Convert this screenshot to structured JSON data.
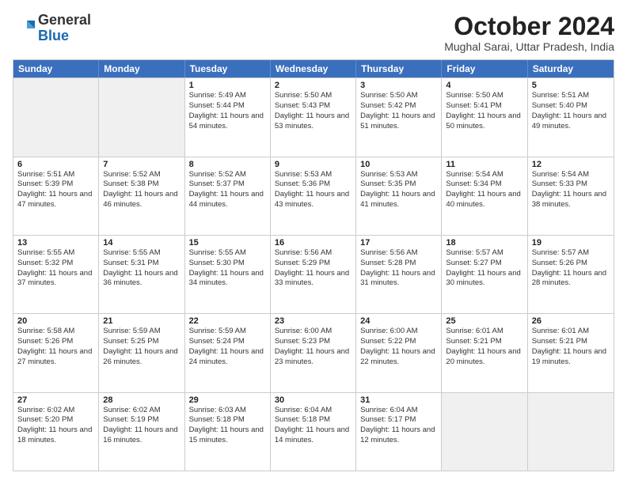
{
  "logo": {
    "general": "General",
    "blue": "Blue"
  },
  "header": {
    "month": "October 2024",
    "location": "Mughal Sarai, Uttar Pradesh, India"
  },
  "weekdays": [
    "Sunday",
    "Monday",
    "Tuesday",
    "Wednesday",
    "Thursday",
    "Friday",
    "Saturday"
  ],
  "rows": [
    [
      {
        "day": "",
        "sunrise": "",
        "sunset": "",
        "daylight": "",
        "shaded": true
      },
      {
        "day": "",
        "sunrise": "",
        "sunset": "",
        "daylight": "",
        "shaded": true
      },
      {
        "day": "1",
        "sunrise": "Sunrise: 5:49 AM",
        "sunset": "Sunset: 5:44 PM",
        "daylight": "Daylight: 11 hours and 54 minutes."
      },
      {
        "day": "2",
        "sunrise": "Sunrise: 5:50 AM",
        "sunset": "Sunset: 5:43 PM",
        "daylight": "Daylight: 11 hours and 53 minutes."
      },
      {
        "day": "3",
        "sunrise": "Sunrise: 5:50 AM",
        "sunset": "Sunset: 5:42 PM",
        "daylight": "Daylight: 11 hours and 51 minutes."
      },
      {
        "day": "4",
        "sunrise": "Sunrise: 5:50 AM",
        "sunset": "Sunset: 5:41 PM",
        "daylight": "Daylight: 11 hours and 50 minutes."
      },
      {
        "day": "5",
        "sunrise": "Sunrise: 5:51 AM",
        "sunset": "Sunset: 5:40 PM",
        "daylight": "Daylight: 11 hours and 49 minutes."
      }
    ],
    [
      {
        "day": "6",
        "sunrise": "Sunrise: 5:51 AM",
        "sunset": "Sunset: 5:39 PM",
        "daylight": "Daylight: 11 hours and 47 minutes."
      },
      {
        "day": "7",
        "sunrise": "Sunrise: 5:52 AM",
        "sunset": "Sunset: 5:38 PM",
        "daylight": "Daylight: 11 hours and 46 minutes."
      },
      {
        "day": "8",
        "sunrise": "Sunrise: 5:52 AM",
        "sunset": "Sunset: 5:37 PM",
        "daylight": "Daylight: 11 hours and 44 minutes."
      },
      {
        "day": "9",
        "sunrise": "Sunrise: 5:53 AM",
        "sunset": "Sunset: 5:36 PM",
        "daylight": "Daylight: 11 hours and 43 minutes."
      },
      {
        "day": "10",
        "sunrise": "Sunrise: 5:53 AM",
        "sunset": "Sunset: 5:35 PM",
        "daylight": "Daylight: 11 hours and 41 minutes."
      },
      {
        "day": "11",
        "sunrise": "Sunrise: 5:54 AM",
        "sunset": "Sunset: 5:34 PM",
        "daylight": "Daylight: 11 hours and 40 minutes."
      },
      {
        "day": "12",
        "sunrise": "Sunrise: 5:54 AM",
        "sunset": "Sunset: 5:33 PM",
        "daylight": "Daylight: 11 hours and 38 minutes."
      }
    ],
    [
      {
        "day": "13",
        "sunrise": "Sunrise: 5:55 AM",
        "sunset": "Sunset: 5:32 PM",
        "daylight": "Daylight: 11 hours and 37 minutes."
      },
      {
        "day": "14",
        "sunrise": "Sunrise: 5:55 AM",
        "sunset": "Sunset: 5:31 PM",
        "daylight": "Daylight: 11 hours and 36 minutes."
      },
      {
        "day": "15",
        "sunrise": "Sunrise: 5:55 AM",
        "sunset": "Sunset: 5:30 PM",
        "daylight": "Daylight: 11 hours and 34 minutes."
      },
      {
        "day": "16",
        "sunrise": "Sunrise: 5:56 AM",
        "sunset": "Sunset: 5:29 PM",
        "daylight": "Daylight: 11 hours and 33 minutes."
      },
      {
        "day": "17",
        "sunrise": "Sunrise: 5:56 AM",
        "sunset": "Sunset: 5:28 PM",
        "daylight": "Daylight: 11 hours and 31 minutes."
      },
      {
        "day": "18",
        "sunrise": "Sunrise: 5:57 AM",
        "sunset": "Sunset: 5:27 PM",
        "daylight": "Daylight: 11 hours and 30 minutes."
      },
      {
        "day": "19",
        "sunrise": "Sunrise: 5:57 AM",
        "sunset": "Sunset: 5:26 PM",
        "daylight": "Daylight: 11 hours and 28 minutes."
      }
    ],
    [
      {
        "day": "20",
        "sunrise": "Sunrise: 5:58 AM",
        "sunset": "Sunset: 5:26 PM",
        "daylight": "Daylight: 11 hours and 27 minutes."
      },
      {
        "day": "21",
        "sunrise": "Sunrise: 5:59 AM",
        "sunset": "Sunset: 5:25 PM",
        "daylight": "Daylight: 11 hours and 26 minutes."
      },
      {
        "day": "22",
        "sunrise": "Sunrise: 5:59 AM",
        "sunset": "Sunset: 5:24 PM",
        "daylight": "Daylight: 11 hours and 24 minutes."
      },
      {
        "day": "23",
        "sunrise": "Sunrise: 6:00 AM",
        "sunset": "Sunset: 5:23 PM",
        "daylight": "Daylight: 11 hours and 23 minutes."
      },
      {
        "day": "24",
        "sunrise": "Sunrise: 6:00 AM",
        "sunset": "Sunset: 5:22 PM",
        "daylight": "Daylight: 11 hours and 22 minutes."
      },
      {
        "day": "25",
        "sunrise": "Sunrise: 6:01 AM",
        "sunset": "Sunset: 5:21 PM",
        "daylight": "Daylight: 11 hours and 20 minutes."
      },
      {
        "day": "26",
        "sunrise": "Sunrise: 6:01 AM",
        "sunset": "Sunset: 5:21 PM",
        "daylight": "Daylight: 11 hours and 19 minutes."
      }
    ],
    [
      {
        "day": "27",
        "sunrise": "Sunrise: 6:02 AM",
        "sunset": "Sunset: 5:20 PM",
        "daylight": "Daylight: 11 hours and 18 minutes."
      },
      {
        "day": "28",
        "sunrise": "Sunrise: 6:02 AM",
        "sunset": "Sunset: 5:19 PM",
        "daylight": "Daylight: 11 hours and 16 minutes."
      },
      {
        "day": "29",
        "sunrise": "Sunrise: 6:03 AM",
        "sunset": "Sunset: 5:18 PM",
        "daylight": "Daylight: 11 hours and 15 minutes."
      },
      {
        "day": "30",
        "sunrise": "Sunrise: 6:04 AM",
        "sunset": "Sunset: 5:18 PM",
        "daylight": "Daylight: 11 hours and 14 minutes."
      },
      {
        "day": "31",
        "sunrise": "Sunrise: 6:04 AM",
        "sunset": "Sunset: 5:17 PM",
        "daylight": "Daylight: 11 hours and 12 minutes."
      },
      {
        "day": "",
        "sunrise": "",
        "sunset": "",
        "daylight": "",
        "shaded": true
      },
      {
        "day": "",
        "sunrise": "",
        "sunset": "",
        "daylight": "",
        "shaded": true
      }
    ]
  ]
}
